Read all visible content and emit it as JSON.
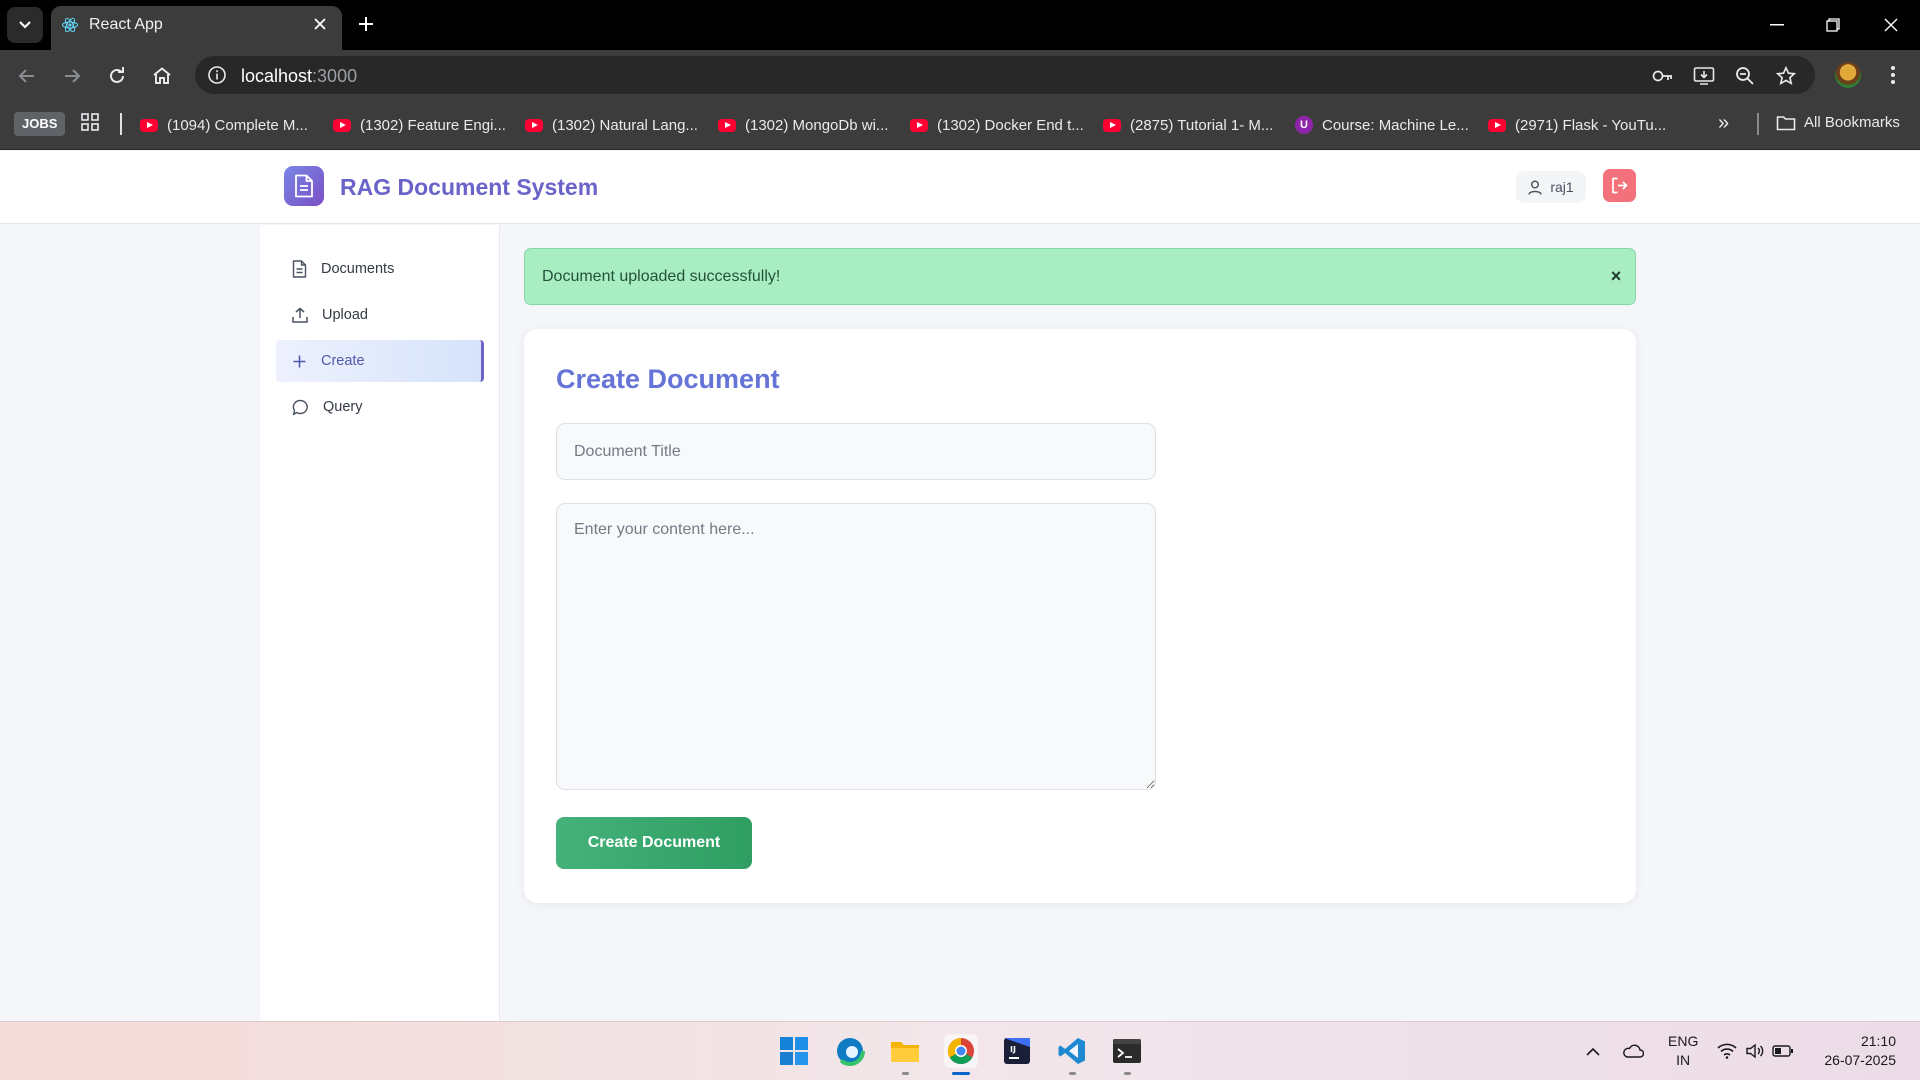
{
  "browser": {
    "tab_title": "React App",
    "url_host": "localhost",
    "url_port": ":3000",
    "bookmarks": [
      {
        "label": "(1094) Complete M...",
        "icon": "youtube-icon"
      },
      {
        "label": "(1302) Feature Engi...",
        "icon": "youtube-icon"
      },
      {
        "label": "(1302) Natural Lang...",
        "icon": "youtube-icon"
      },
      {
        "label": "(1302) MongoDb wi...",
        "icon": "youtube-icon"
      },
      {
        "label": "(1302) Docker End t...",
        "icon": "youtube-icon"
      },
      {
        "label": "(2875) Tutorial 1- M...",
        "icon": "youtube-icon"
      },
      {
        "label": "Course: Machine Le...",
        "icon": "course-icon"
      },
      {
        "label": "(2971) Flask - YouTu...",
        "icon": "youtube-icon"
      }
    ],
    "jobs_label": "JOBS",
    "all_bookmarks_label": "All Bookmarks",
    "more_label": "»"
  },
  "app": {
    "brand": "RAG Document System",
    "username": "raj1",
    "accent_color": "#6a63c9",
    "success_color": "#3aa96e",
    "logout_color": "#f2717a"
  },
  "sidebar": {
    "items": [
      {
        "label": "Documents",
        "icon": "document-icon",
        "active": false
      },
      {
        "label": "Upload",
        "icon": "upload-icon",
        "active": false
      },
      {
        "label": "Create",
        "icon": "plus-icon",
        "active": true
      },
      {
        "label": "Query",
        "icon": "chat-bubble-icon",
        "active": false
      }
    ]
  },
  "alert": {
    "message": "Document uploaded successfully!",
    "close_label": "×"
  },
  "form": {
    "heading": "Create Document",
    "title_placeholder": "Document Title",
    "title_value": "",
    "content_placeholder": "Enter your content here...",
    "content_value": "",
    "submit_label": "Create Document"
  },
  "taskbar": {
    "apps": [
      "windows-start-icon",
      "edge-icon",
      "file-explorer-icon",
      "chrome-icon",
      "jetbrains-icon",
      "vscode-icon",
      "terminal-icon"
    ],
    "lang_line1": "ENG",
    "lang_line2": "IN",
    "time": "21:10",
    "date": "26-07-2025"
  }
}
